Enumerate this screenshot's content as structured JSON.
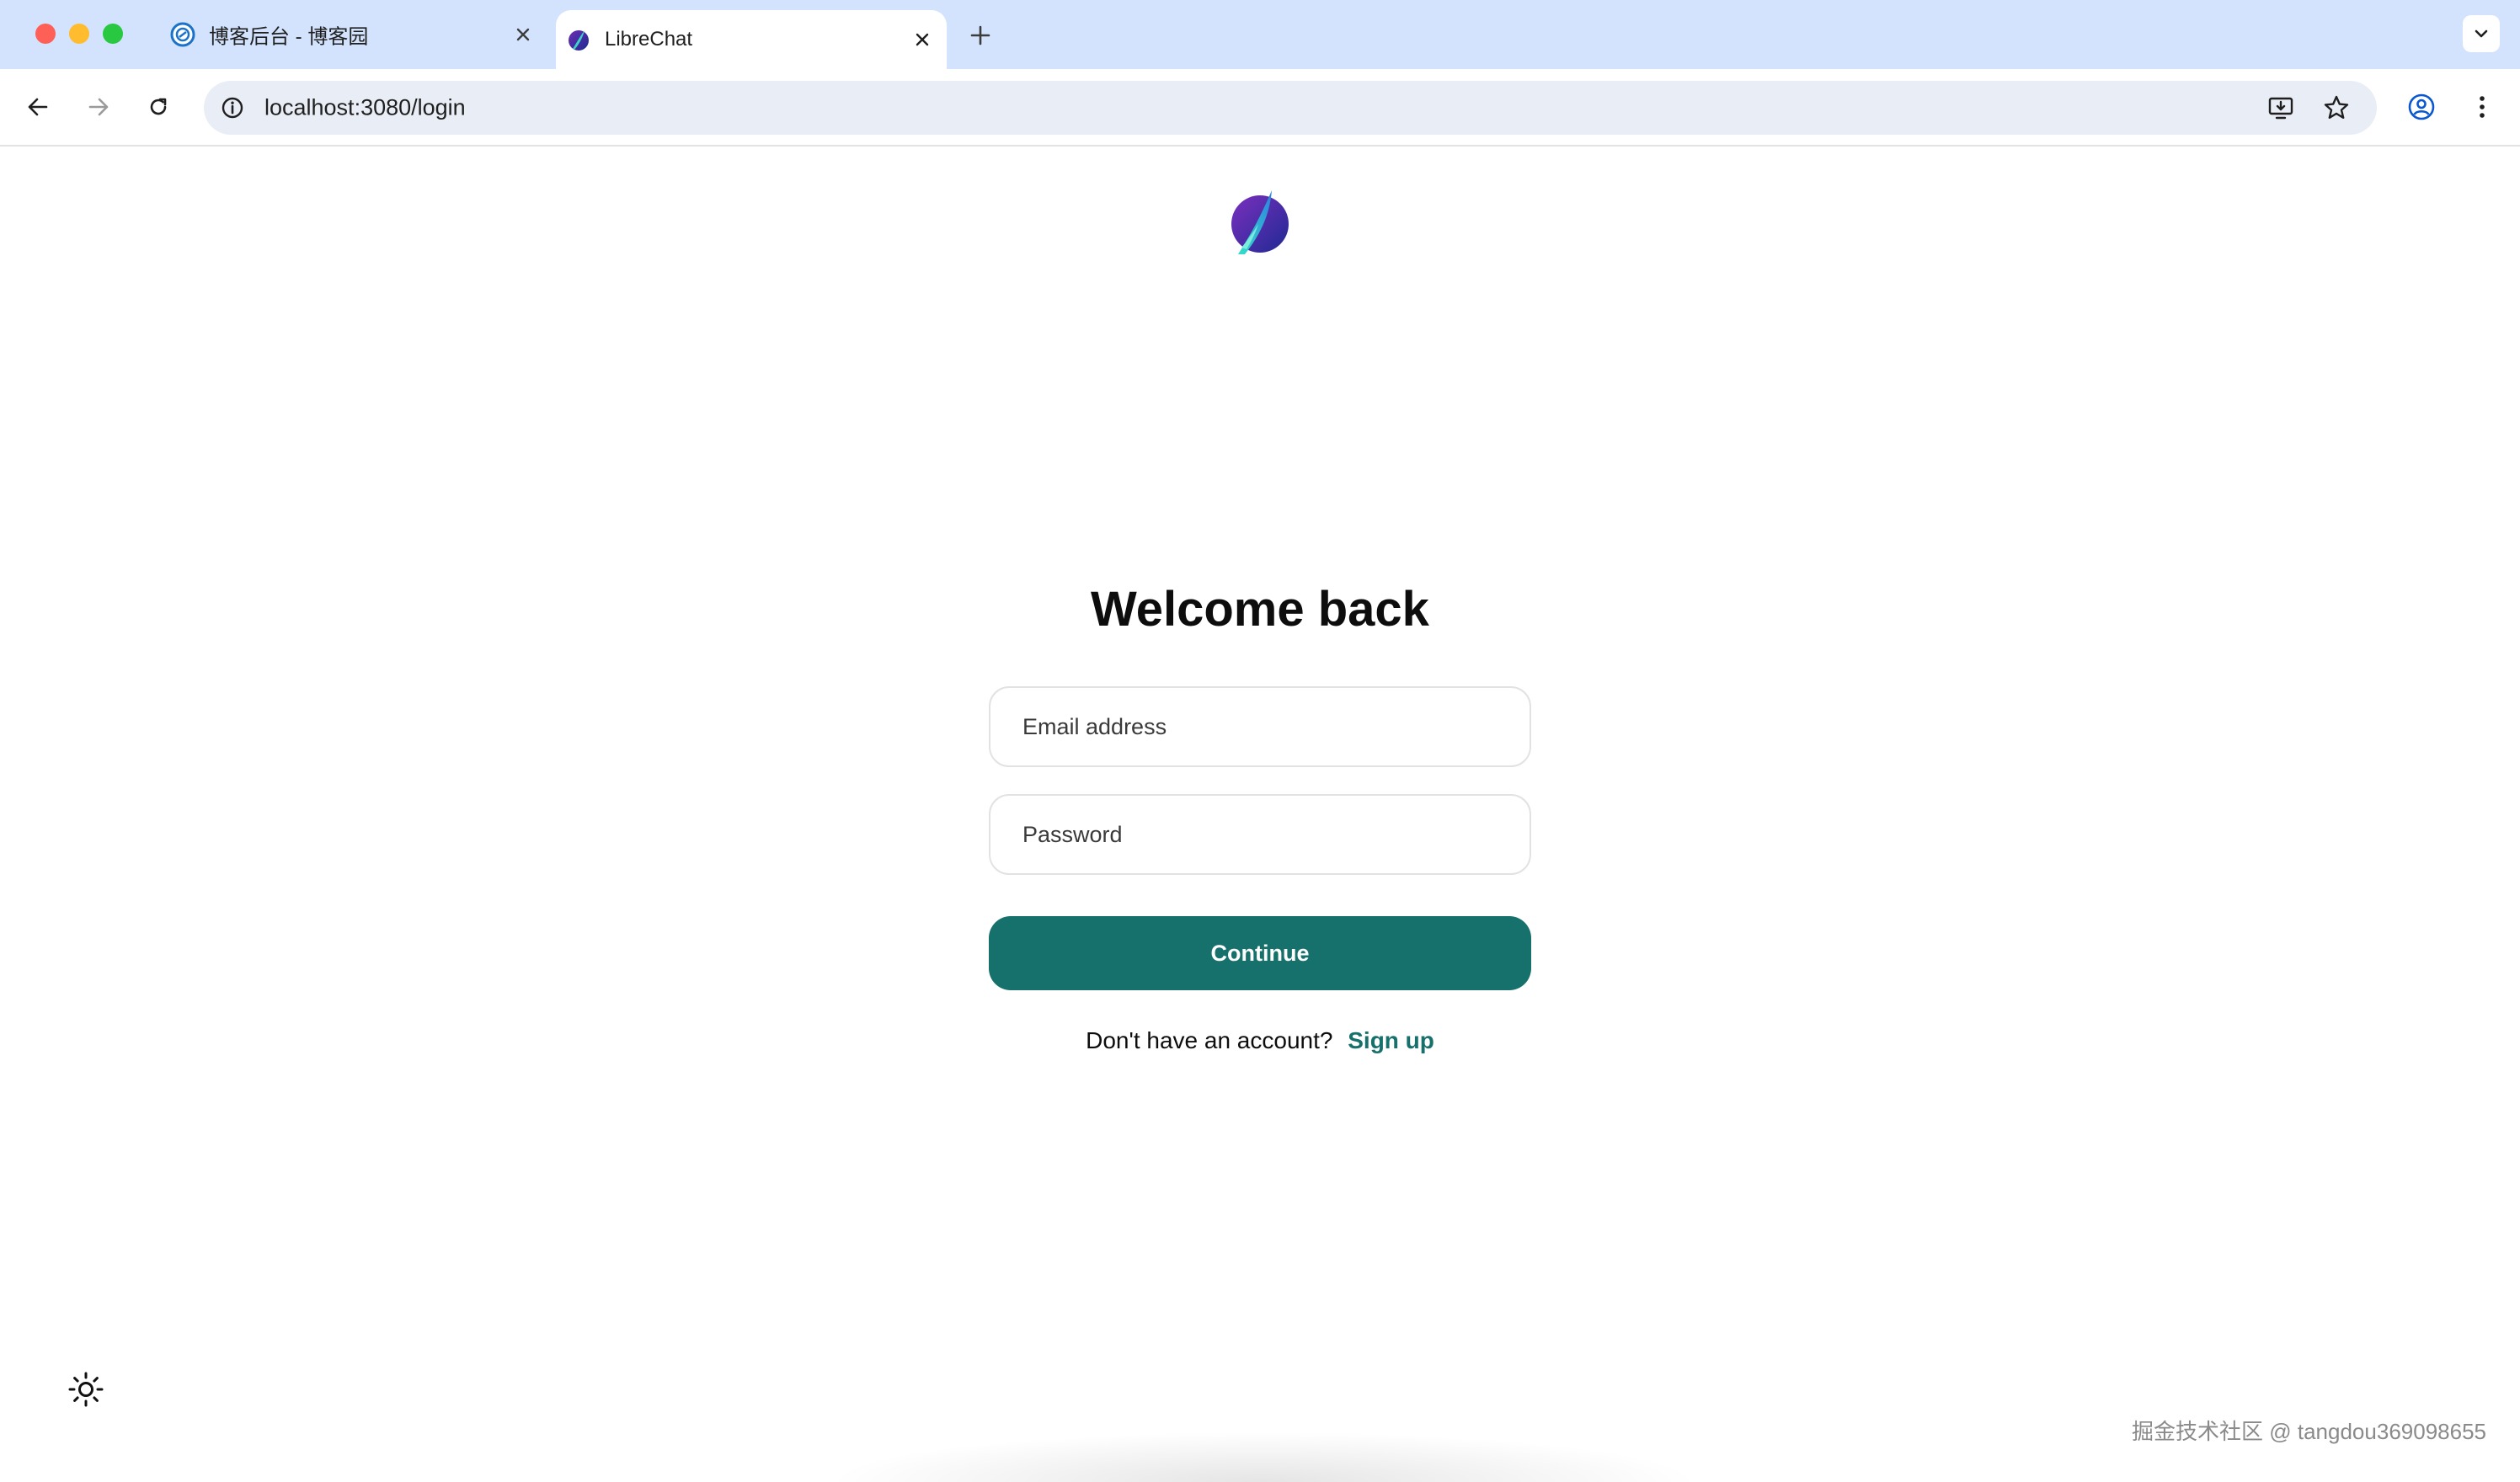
{
  "browser": {
    "tabs": [
      {
        "title": "博客后台 - 博客园",
        "active": false,
        "favicon": "cnblogs-icon"
      },
      {
        "title": "LibreChat",
        "active": true,
        "favicon": "librechat-icon"
      }
    ],
    "url": "localhost:3080/login"
  },
  "login": {
    "heading": "Welcome back",
    "email_placeholder": "Email address",
    "password_placeholder": "Password",
    "continue_label": "Continue",
    "signup_prompt": "Don't have an account?",
    "signup_link": "Sign up"
  },
  "theme_toggle_icon": "sun-icon",
  "watermark": "掘金技术社区 @ tangdou369098655",
  "colors": {
    "accent": "#16706b",
    "tabstrip": "#d3e3fd",
    "omnibox": "#e9eef6"
  }
}
